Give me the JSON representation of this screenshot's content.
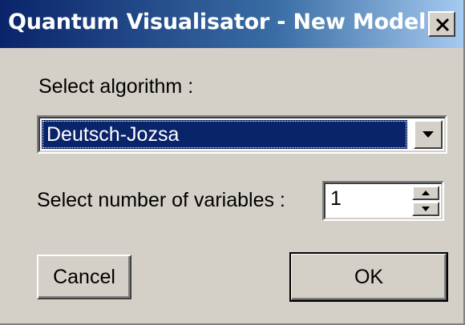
{
  "window": {
    "title": "Quantum Visualisator - New Model",
    "close_glyph": "X"
  },
  "algorithm": {
    "label": "Select algorithm :",
    "selected": "Deutsch-Jozsa"
  },
  "variables": {
    "label": "Select number of variables :",
    "value": "1"
  },
  "buttons": {
    "cancel": "Cancel",
    "ok": "OK"
  },
  "colors": {
    "title_bar": "#0a246a",
    "selection": "#0a246a",
    "face": "#d4d0c8"
  },
  "icons": {
    "close": "close-icon",
    "dropdown": "chevron-down-icon",
    "spin_up": "spin-up-icon",
    "spin_down": "spin-down-icon"
  }
}
